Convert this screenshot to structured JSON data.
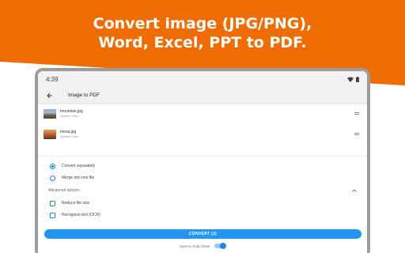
{
  "brand": {
    "accent": "#ef6c00",
    "primary": "#2196f3"
  },
  "headline": {
    "line1": "Convert image (JPG/PNG),",
    "line2": "Word, Excel, PPT to PDF."
  },
  "statusbar": {
    "time": "4:39",
    "icons": [
      "wifi-icon",
      "battery-icon"
    ]
  },
  "appbar": {
    "back_icon": "arrow-left-icon",
    "title": "Image to PDF"
  },
  "files": [
    {
      "name": "mountain.jpg",
      "source": "System Files",
      "thumb": "mountain"
    },
    {
      "name": "mesa.jpg",
      "source": "System Files",
      "thumb": "mesa"
    }
  ],
  "options": {
    "convert_separately": {
      "label": "Convert separately",
      "selected": true
    },
    "merge_into_one": {
      "label": "Merge into one file",
      "selected": false
    },
    "advanced_label": "Advanced options",
    "reduce_file_size": {
      "label": "Reduce file size",
      "checked": false
    },
    "recognize_text": {
      "label": "Recognize text (OCR)",
      "checked": false
    }
  },
  "convert_button": {
    "label": "CONVERT (2)"
  },
  "drive": {
    "label": "Save to Xodo Drive",
    "enabled": true
  }
}
